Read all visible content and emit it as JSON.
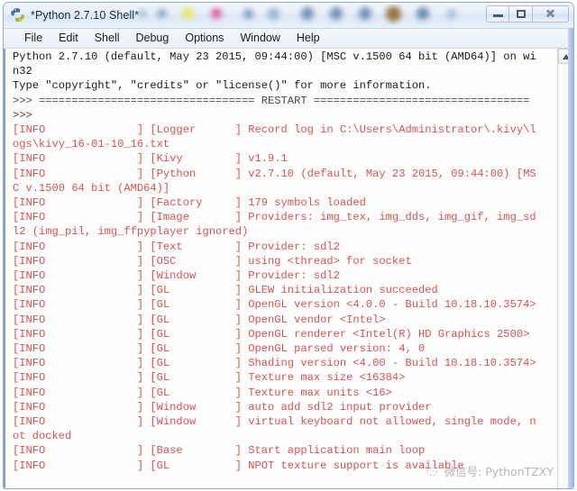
{
  "window": {
    "title": "*Python 2.7.10 Shell*",
    "icon": "python-idle-icon",
    "controls": {
      "minimize_label": "–",
      "maximize_label": "□",
      "close_label": "✕"
    }
  },
  "menubar": {
    "items": [
      {
        "label": "File"
      },
      {
        "label": "Edit"
      },
      {
        "label": "Shell"
      },
      {
        "label": "Debug"
      },
      {
        "label": "Options"
      },
      {
        "label": "Window"
      },
      {
        "label": "Help"
      }
    ]
  },
  "scrollbar": {
    "up_arrow": "scroll-up-arrow-icon"
  },
  "watermark": {
    "text": "微信号: PythonTZXY"
  },
  "colors": {
    "log_text": "#d9534f",
    "stdout_text": "#1b1b1b",
    "prompt_text": "#7a2828",
    "restart_text": "#4a4a4a",
    "titlebar_border": "#8faed4",
    "window_border_left": "#7d9fcb"
  },
  "console": {
    "lines": [
      {
        "id": "banner-1",
        "cls": "c-stdout",
        "text": "Python 2.7.10 (default, May 23 2015, 09:44:00) [MSC v.1500 64 bit (AMD64)] on wi"
      },
      {
        "id": "banner-2",
        "cls": "c-stdout",
        "text": "n32"
      },
      {
        "id": "banner-3",
        "cls": "c-stdout",
        "text": "Type \"copyright\", \"credits\" or \"license()\" for more information."
      },
      {
        "id": "restart-line",
        "cls": "c-restart",
        "text": ">>> ================================= RESTART ================================="
      },
      {
        "id": "prompt-1",
        "cls": "c-prompt",
        "text": ">>> "
      },
      {
        "id": "log-logger-1",
        "cls": "c-log",
        "text": "[INFO              ] [Logger      ] Record log in C:\\Users\\Administrator\\.kivy\\l"
      },
      {
        "id": "log-logger-2",
        "cls": "c-log",
        "text": "ogs\\kivy_16-01-10_16.txt"
      },
      {
        "id": "log-kivy",
        "cls": "c-log",
        "text": "[INFO              ] [Kivy        ] v1.9.1"
      },
      {
        "id": "log-python-1",
        "cls": "c-log",
        "text": "[INFO              ] [Python      ] v2.7.10 (default, May 23 2015, 09:44:00) [MS"
      },
      {
        "id": "log-python-2",
        "cls": "c-log",
        "text": "C v.1500 64 bit (AMD64)]"
      },
      {
        "id": "log-factory",
        "cls": "c-log",
        "text": "[INFO              ] [Factory     ] 179 symbols loaded"
      },
      {
        "id": "log-image-1",
        "cls": "c-log",
        "text": "[INFO              ] [Image       ] Providers: img_tex, img_dds, img_gif, img_sd"
      },
      {
        "id": "log-image-2",
        "cls": "c-log",
        "text": "l2 (img_pil, img_ffpyplayer ignored)"
      },
      {
        "id": "log-text",
        "cls": "c-log",
        "text": "[INFO              ] [Text        ] Provider: sdl2"
      },
      {
        "id": "log-osc",
        "cls": "c-log",
        "text": "[INFO              ] [OSC         ] using <thread> for socket"
      },
      {
        "id": "log-window-provider",
        "cls": "c-log",
        "text": "[INFO              ] [Window      ] Provider: sdl2"
      },
      {
        "id": "log-gl-glew",
        "cls": "c-log",
        "text": "[INFO              ] [GL          ] GLEW initialization succeeded"
      },
      {
        "id": "log-gl-version",
        "cls": "c-log",
        "text": "[INFO              ] [GL          ] OpenGL version <4.0.0 - Build 10.18.10.3574>"
      },
      {
        "id": "log-gl-vendor",
        "cls": "c-log",
        "text": "[INFO              ] [GL          ] OpenGL vendor <Intel>"
      },
      {
        "id": "log-gl-renderer",
        "cls": "c-log",
        "text": "[INFO              ] [GL          ] OpenGL renderer <Intel(R) HD Graphics 2500>"
      },
      {
        "id": "log-gl-parsed",
        "cls": "c-log",
        "text": "[INFO              ] [GL          ] OpenGL parsed version: 4, 0"
      },
      {
        "id": "log-gl-shading",
        "cls": "c-log",
        "text": "[INFO              ] [GL          ] Shading version <4.00 - Build 10.18.10.3574>"
      },
      {
        "id": "log-gl-texsize",
        "cls": "c-log",
        "text": "[INFO              ] [GL          ] Texture max size <16384>"
      },
      {
        "id": "log-gl-texunits",
        "cls": "c-log",
        "text": "[INFO              ] [GL          ] Texture max units <16>"
      },
      {
        "id": "log-window-input",
        "cls": "c-log",
        "text": "[INFO              ] [Window      ] auto add sdl2 input provider"
      },
      {
        "id": "log-window-keyboard-1",
        "cls": "c-log",
        "text": "[INFO              ] [Window      ] virtual keyboard not allowed, single mode, n"
      },
      {
        "id": "log-window-keyboard-2",
        "cls": "c-log",
        "text": "ot docked"
      },
      {
        "id": "log-base",
        "cls": "c-log",
        "text": "[INFO              ] [Base        ] Start application main loop"
      },
      {
        "id": "log-gl-npot",
        "cls": "c-log",
        "text": "[INFO              ] [GL          ] NPOT texture support is available"
      }
    ]
  }
}
